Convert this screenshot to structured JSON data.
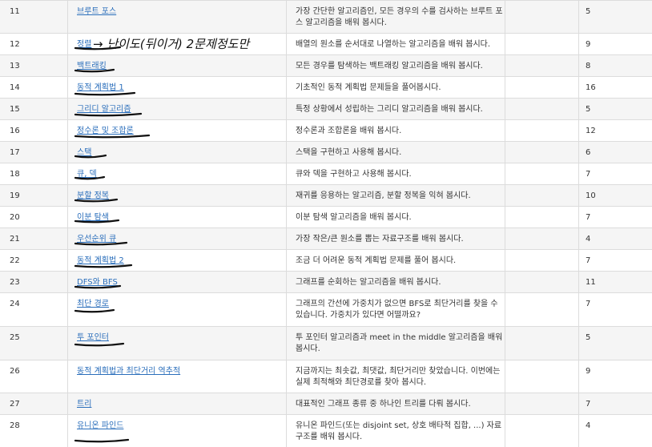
{
  "rows": [
    {
      "num": "11",
      "title": "브루트 포스",
      "desc": "가장 간단한 알고리즘인, 모든 경우의 수를 검사하는 브루트 포스 알고리즘을 배워 봅시다.",
      "count": "5"
    },
    {
      "num": "12",
      "title": "정렬",
      "desc": "배열의 원소를 순서대로 나열하는 알고리즘을 배워 봅시다.",
      "count": "9"
    },
    {
      "num": "13",
      "title": "백트래킹",
      "desc": "모든 경우를 탐색하는 백트래킹 알고리즘을 배워 봅시다.",
      "count": "8"
    },
    {
      "num": "14",
      "title": "동적 계획법 1",
      "desc": "기초적인 동적 계획법 문제들을 풀어봅시다.",
      "count": "16"
    },
    {
      "num": "15",
      "title": "그리디 알고리즘",
      "desc": "특정 상황에서 성립하는 그리디 알고리즘을 배워 봅시다.",
      "count": "5"
    },
    {
      "num": "16",
      "title": "정수론 및 조합론",
      "desc": "정수론과 조합론을 배워 봅시다.",
      "count": "12"
    },
    {
      "num": "17",
      "title": "스택",
      "desc": "스택을 구현하고 사용해 봅시다.",
      "count": "6"
    },
    {
      "num": "18",
      "title": "큐, 덱",
      "desc": "큐와 덱을 구현하고 사용해 봅시다.",
      "count": "7"
    },
    {
      "num": "19",
      "title": "분할 정복",
      "desc": "재귀를 응용하는 알고리즘, 분할 정복을 익혀 봅시다.",
      "count": "10"
    },
    {
      "num": "20",
      "title": "이분 탐색",
      "desc": "이분 탐색 알고리즘을 배워 봅시다.",
      "count": "7"
    },
    {
      "num": "21",
      "title": "우선순위 큐",
      "desc": "가장 작은/큰 원소를 뽑는 자료구조를 배워 봅시다.",
      "count": "4"
    },
    {
      "num": "22",
      "title": "동적 계획법 2",
      "desc": "조금 더 어려운 동적 계획법 문제를 풀어 봅시다.",
      "count": "7"
    },
    {
      "num": "23",
      "title": "DFS와 BFS",
      "desc": "그래프를 순회하는 알고리즘을 배워 봅시다.",
      "count": "11"
    },
    {
      "num": "24",
      "title": "최단 경로",
      "desc": "그래프의 간선에 가중치가 없으면 BFS로 최단거리를 찾을 수 있습니다. 가중치가 있다면 어떨까요?",
      "count": "7"
    },
    {
      "num": "25",
      "title": "투 포인터",
      "desc": "투 포인터 알고리즘과 meet in the middle 알고리즘을 배워 봅시다.",
      "count": "5"
    },
    {
      "num": "26",
      "title": "동적 계획법과 최단거리 역추적",
      "desc": "지금까지는 최솟값, 최댓값, 최단거리만 찾았습니다. 이번에는 실제 최적해와 최단경로를 찾아 봅시다.",
      "count": "9"
    },
    {
      "num": "27",
      "title": "트리",
      "desc": "대표적인 그래프 종류 중 하나인 트리를 다뤄 봅시다.",
      "count": "7"
    },
    {
      "num": "28",
      "title": "유니온 파인드",
      "desc": "유니온 파인드(또는 disjoint set, 상호 배타적 집합, ...) 자료구조를 배워 봅시다.",
      "count": "4"
    }
  ],
  "annotation": {
    "note": "→ 난이도(뒤이거) 2문제정도만",
    "color": "#111111"
  }
}
